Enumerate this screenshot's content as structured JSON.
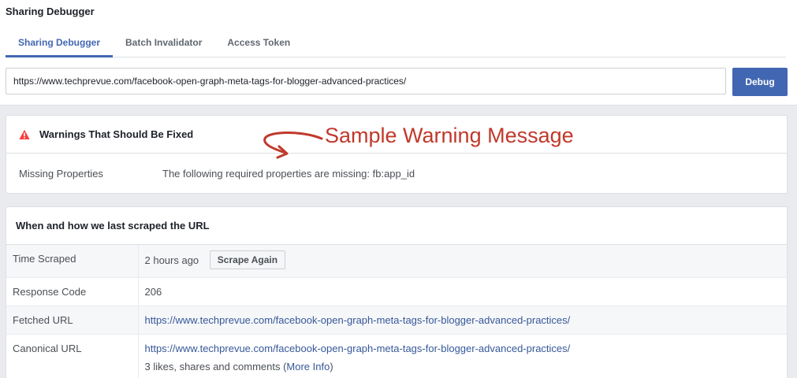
{
  "app": {
    "title": "Sharing Debugger"
  },
  "tabs": [
    {
      "label": "Sharing Debugger",
      "active": true
    },
    {
      "label": "Batch Invalidator",
      "active": false
    },
    {
      "label": "Access Token",
      "active": false
    }
  ],
  "url_input": {
    "value": "https://www.techprevue.com/facebook-open-graph-meta-tags-for-blogger-advanced-practices/"
  },
  "debug_button": {
    "label": "Debug"
  },
  "warnings": {
    "title": "Warnings That Should Be Fixed",
    "icon": "warning-triangle-icon",
    "icon_color": "#fa3e3e",
    "rows": [
      {
        "label": "Missing Properties",
        "message": "The following required properties are missing: fb:app_id"
      }
    ]
  },
  "annotation": {
    "text": "Sample Warning Message",
    "color": "#c0392b",
    "icon": "curved-arrow-icon"
  },
  "scrape": {
    "title": "When and how we last scraped the URL",
    "time_scraped": {
      "label": "Time Scraped",
      "value": "2 hours ago",
      "button": "Scrape Again"
    },
    "response_code": {
      "label": "Response Code",
      "value": "206"
    },
    "fetched_url": {
      "label": "Fetched URL",
      "value": "https://www.techprevue.com/facebook-open-graph-meta-tags-for-blogger-advanced-practices/"
    },
    "canonical_url": {
      "label": "Canonical URL",
      "value": "https://www.techprevue.com/facebook-open-graph-meta-tags-for-blogger-advanced-practices/",
      "engagement": "3 likes, shares and comments (",
      "more_info": "More Info",
      "engagement_end": ")"
    }
  },
  "colors": {
    "accent": "#4267b2",
    "link": "#365899",
    "background": "#e9ebee"
  }
}
